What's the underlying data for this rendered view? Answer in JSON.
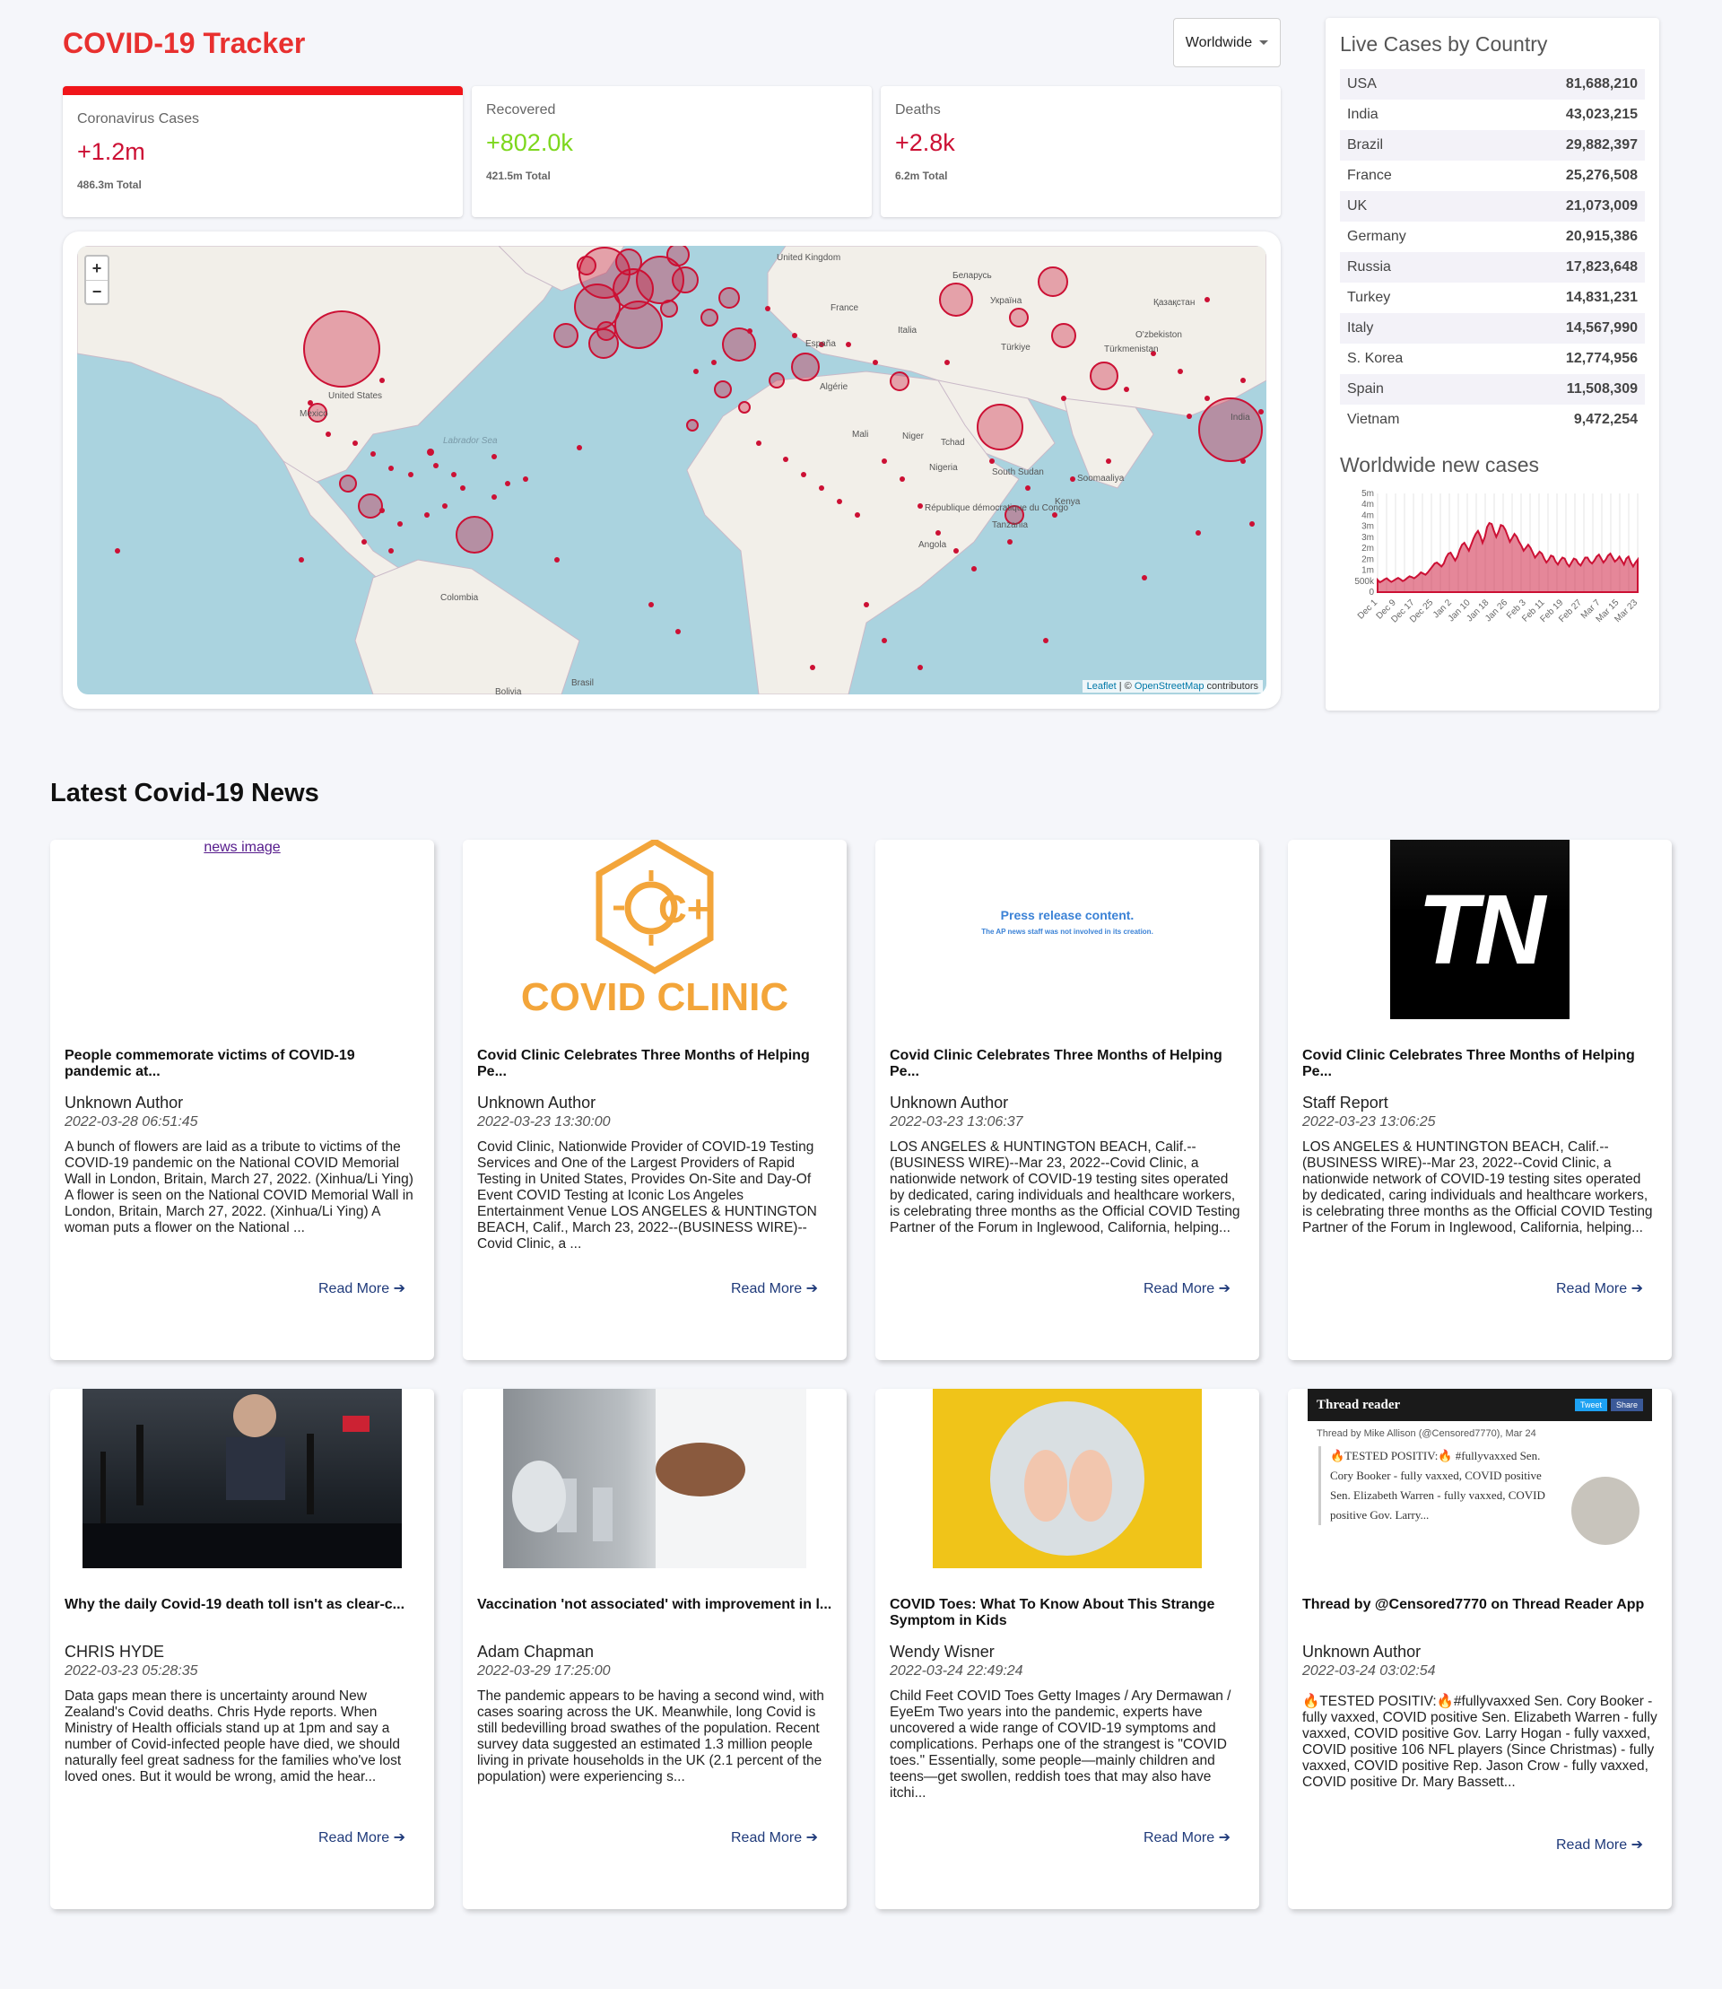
{
  "header": {
    "title": "COVID-19 Tracker",
    "region": "Worldwide"
  },
  "stats": [
    {
      "label": "Coronavirus Cases",
      "value": "+1.2m",
      "total": "486.3m Total"
    },
    {
      "label": "Recovered",
      "value": "+802.0k",
      "total": "421.5m Total"
    },
    {
      "label": "Deaths",
      "value": "+2.8k",
      "total": "6.2m Total"
    }
  ],
  "map": {
    "zoom_in": "+",
    "zoom_out": "−",
    "attribution_leaflet": "Leaflet",
    "attribution_sep": " | © ",
    "attribution_osm": "OpenStreetMap",
    "attribution_tail": " contributors",
    "labels": {
      "us": "United States",
      "mexico": "Mexico",
      "colombia": "Colombia",
      "brasil": "Brasil",
      "bolivia": "Bolivia",
      "uk": "United Kingdom",
      "france": "France",
      "espana": "España",
      "italia": "Italia",
      "turkiye": "Türkiye",
      "india": "India",
      "nigeria": "Nigeria",
      "mali": "Mali",
      "niger": "Niger",
      "tchad": "Tchad",
      "algerie": "Algérie",
      "south_sudan": "South Sudan",
      "kenya": "Kenya",
      "angola": "Angola",
      "tanzania": "Tanzania",
      "rdc": "République démocratique du Congo",
      "soomaaliya": "Soomaaliya",
      "turkmenistan": "Türkmenistan",
      "uzbekistan": "O'zbekiston",
      "kazakhstan": "Қазақстан",
      "ukraine": "Україна",
      "belarus": "Беларусь",
      "labrador": "Labrador Sea"
    }
  },
  "countries_panel": {
    "title": "Live Cases by Country",
    "rows": [
      {
        "name": "USA",
        "cases": "81,688,210"
      },
      {
        "name": "India",
        "cases": "43,023,215"
      },
      {
        "name": "Brazil",
        "cases": "29,882,397"
      },
      {
        "name": "France",
        "cases": "25,276,508"
      },
      {
        "name": "UK",
        "cases": "21,073,009"
      },
      {
        "name": "Germany",
        "cases": "20,915,386"
      },
      {
        "name": "Russia",
        "cases": "17,823,648"
      },
      {
        "name": "Turkey",
        "cases": "14,831,231"
      },
      {
        "name": "Italy",
        "cases": "14,567,990"
      },
      {
        "name": "S. Korea",
        "cases": "12,774,956"
      },
      {
        "name": "Spain",
        "cases": "11,508,309"
      },
      {
        "name": "Vietnam",
        "cases": "9,472,254"
      }
    ]
  },
  "chart_title": "Worldwide new cases",
  "chart_data": {
    "type": "area",
    "title": "Worldwide new cases",
    "y_ticks": [
      "0",
      "500k",
      "1m",
      "2m",
      "2m",
      "3m",
      "3m",
      "4m",
      "4m",
      "5m"
    ],
    "ylim": [
      0,
      5000000
    ],
    "x_ticks": [
      "Dec 1",
      "Dec 9",
      "Dec 17",
      "Dec 25",
      "Jan 2",
      "Jan 10",
      "Jan 18",
      "Jan 26",
      "Feb 3",
      "Feb 11",
      "Feb 19",
      "Feb 27",
      "Mar 7",
      "Mar 15",
      "Mar 23"
    ],
    "grid": true,
    "color": "#cc1034",
    "values": [
      620000,
      500000,
      560000,
      640000,
      700000,
      600000,
      520000,
      580000,
      660000,
      720000,
      650000,
      560000,
      620000,
      720000,
      800000,
      760000,
      700000,
      780000,
      880000,
      1000000,
      940000,
      880000,
      1000000,
      1150000,
      1300000,
      1450000,
      1500000,
      1400000,
      1300000,
      1450000,
      1750000,
      1950000,
      2000000,
      1800000,
      1600000,
      1800000,
      2150000,
      2400000,
      2500000,
      2300000,
      2100000,
      2400000,
      2700000,
      2950000,
      3100000,
      2850000,
      2500000,
      2800000,
      3300000,
      3500000,
      3450000,
      3100000,
      2800000,
      3050000,
      3400000,
      3350000,
      3150000,
      2850000,
      2550000,
      2750000,
      2950000,
      2800000,
      2550000,
      2350000,
      2100000,
      2250000,
      2400000,
      2250000,
      2000000,
      1750000,
      1900000,
      2050000,
      1950000,
      1700000,
      1500000,
      1650000,
      1850000,
      1800000,
      1550000,
      1400000,
      1600000,
      1750000,
      1700000,
      1450000,
      1300000,
      1500000,
      1700000,
      1650000,
      1450000,
      1350000,
      1550000,
      1750000,
      1750000,
      1550000,
      1450000,
      1600000,
      1800000,
      1900000,
      1700000,
      1500000,
      1650000,
      1850000,
      1950000,
      1750000,
      1550000,
      1650000,
      1800000,
      1600000,
      1400000,
      1700000,
      1800000,
      1500000,
      1300000,
      1500000,
      1650000
    ]
  },
  "news": {
    "heading": "Latest Covid-19 News",
    "read_more": "Read More",
    "arrow": "➔",
    "broken_img_alt": "news image",
    "clinic_text": "COVID CLINIC",
    "press_line1": "Press release content.",
    "press_line2": "The AP news staff was not involved in its creation.",
    "tn_text": "TN",
    "thread_app": "Thread reader",
    "thread_tweet": "Tweet",
    "thread_share": "Share",
    "thread_by": "Thread by Mike Allison (@Censored7770), Mar 24",
    "thread_quote": "🔥TESTED POSITIV:🔥 #fullyvaxxed Sen. Cory Booker - fully vaxxed, COVID positive Sen. Elizabeth Warren - fully vaxxed, COVID positive Gov. Larry...",
    "articles": [
      {
        "title": "People commemorate victims of COVID-19 pandemic at...",
        "author": "Unknown Author",
        "date": "2022-03-28 06:51:45",
        "description": "A bunch of flowers are laid as a tribute to victims of the COVID-19 pandemic on the National COVID Memorial Wall in London, Britain, March 27, 2022. (Xinhua/Li Ying) A flower is seen on the National COVID Memorial Wall in London, Britain, March 27, 2022. (Xinhua/Li Ying) A woman puts a flower on the National ..."
      },
      {
        "title": "Covid Clinic Celebrates Three Months of Helping Pe...",
        "author": "Unknown Author",
        "date": "2022-03-23 13:30:00",
        "description": "Covid Clinic, Nationwide Provider of COVID-19 Testing Services and One of the Largest Providers of Rapid Testing in United States, Provides On-Site and Day-Of Event COVID Testing at Iconic Los Angeles Entertainment Venue LOS ANGELES & HUNTINGTON BEACH, Calif., March 23, 2022--(BUSINESS WIRE)--Covid Clinic, a ..."
      },
      {
        "title": "Covid Clinic Celebrates Three Months of Helping Pe...",
        "author": "Unknown Author",
        "date": "2022-03-23 13:06:37",
        "description": "LOS ANGELES & HUNTINGTON BEACH, Calif.--(BUSINESS WIRE)--Mar 23, 2022--Covid Clinic, a nationwide network of COVID-19 testing sites operated by dedicated, caring individuals and healthcare workers, is celebrating three months as the Official COVID Testing Partner of the Forum in Inglewood, California, helping..."
      },
      {
        "title": "Covid Clinic Celebrates Three Months of Helping Pe...",
        "author": "Staff Report",
        "date": "2022-03-23 13:06:25",
        "description": "LOS ANGELES & HUNTINGTON BEACH, Calif.--(BUSINESS WIRE)--Mar 23, 2022--Covid Clinic, a nationwide network of COVID-19 testing sites operated by dedicated, caring individuals and healthcare workers, is celebrating three months as the Official COVID Testing Partner of the Forum in Inglewood, California, helping..."
      },
      {
        "title": "Why the daily Covid-19 death toll isn't as clear-c...",
        "author": "CHRIS HYDE",
        "date": "2022-03-23 05:28:35",
        "description": "Data gaps mean there is uncertainty around New Zealand's Covid deaths. Chris Hyde reports. When Ministry of Health officials stand up at 1pm and say a number of Covid-infected people have died, we should naturally feel great sadness for the families who've lost loved ones. But it would be wrong, amid the hear..."
      },
      {
        "title": "Vaccination 'not associated' with improvement in l...",
        "author": "Adam Chapman",
        "date": "2022-03-29 17:25:00",
        "description": "The pandemic appears to be having a second wind, with cases soaring across the UK. Meanwhile, long Covid is still bedevilling broad swathes of the population. Recent survey data suggested an estimated 1.3 million people living in private households in the UK (2.1 percent of the population) were experiencing s..."
      },
      {
        "title": "COVID Toes: What To Know About This Strange Symptom in Kids",
        "author": "Wendy Wisner",
        "date": "2022-03-24 22:49:24",
        "description": "Child Feet COVID Toes Getty Images / Ary Dermawan / EyeEm Two years into the pandemic, experts have uncovered a wide range of COVID-19 symptoms and complications. Perhaps one of the strangest is \"COVID toes.\" Essentially, some people—mainly children and teens—get swollen, reddish toes that may also have itchi..."
      },
      {
        "title": "Thread by @Censored7770 on Thread Reader App",
        "author": "Unknown Author",
        "date": "2022-03-24 03:02:54",
        "description": "🔥TESTED POSITIV:🔥#fullyvaxxed Sen. Cory Booker - fully vaxxed, COVID positive Sen. Elizabeth Warren - fully vaxxed, COVID positive Gov. Larry Hogan - fully vaxxed, COVID positive 106 NFL players (Since Christmas) - fully vaxxed, COVID positive Rep. Jason Crow - fully vaxxed, COVID positive Dr. Mary Bassett..."
      }
    ]
  }
}
